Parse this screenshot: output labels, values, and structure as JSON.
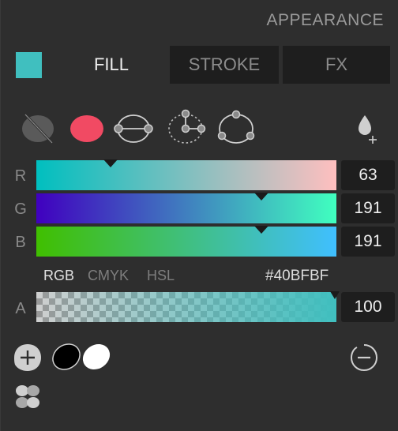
{
  "panel": {
    "title": "APPEARANCE"
  },
  "current_color": "#40BFBF",
  "tabs": [
    {
      "label": "FILL",
      "active": true
    },
    {
      "label": "STROKE",
      "active": false
    },
    {
      "label": "FX",
      "active": false
    }
  ],
  "fill_types": [
    "none-icon",
    "solid-color-icon",
    "linear-gradient-icon",
    "radial-gradient-icon",
    "angular-gradient-icon",
    "eyedropper-icon"
  ],
  "channels": [
    {
      "label": "R",
      "value": "63"
    },
    {
      "label": "G",
      "value": "191"
    },
    {
      "label": "B",
      "value": "191"
    }
  ],
  "alpha": {
    "label": "A",
    "value": "100"
  },
  "modes": {
    "rgb": "RGB",
    "cmyk": "CMYK",
    "hsl": "HSL",
    "active": "RGB"
  },
  "hex": "#40BFBF",
  "bottom_icons": [
    "add-icon",
    "black-white-swatch-icon",
    "remove-icon",
    "blend-icon"
  ]
}
